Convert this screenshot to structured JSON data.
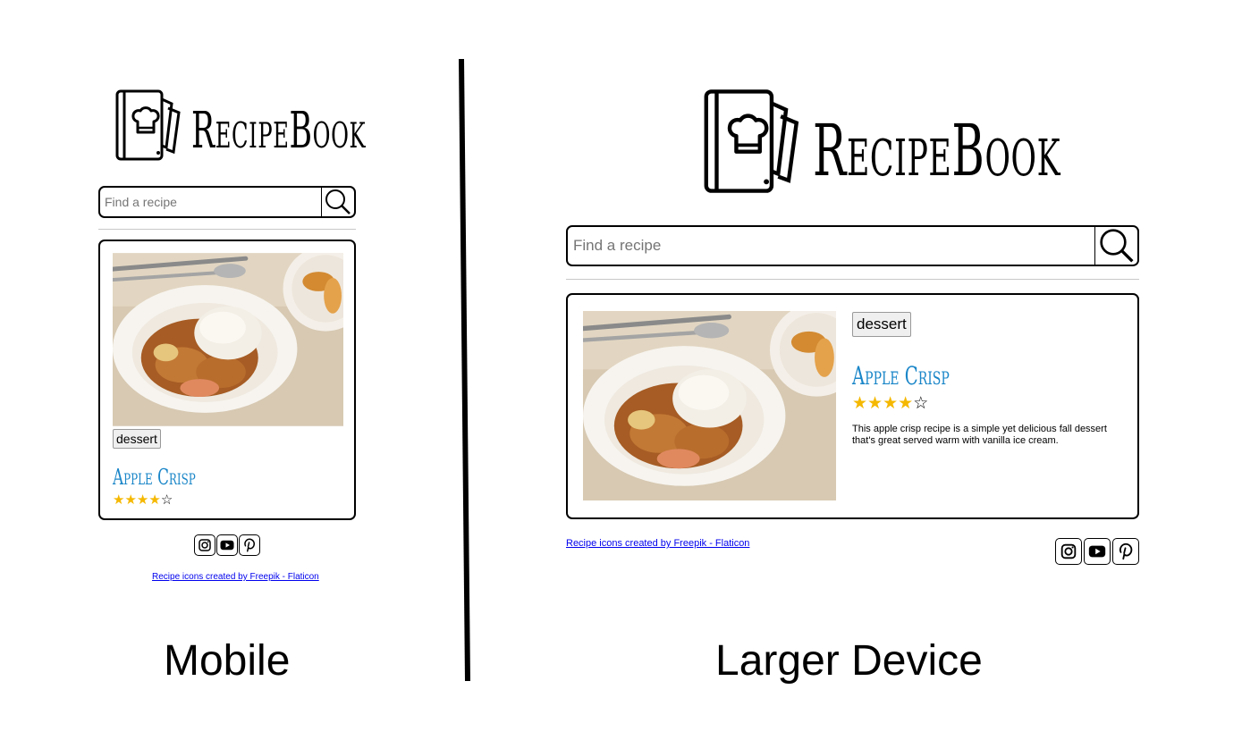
{
  "brand": {
    "name": "RecipeBook"
  },
  "search": {
    "placeholder": "Find a recipe"
  },
  "recipe": {
    "tag": "dessert",
    "title": "Apple Crisp",
    "rating": 4,
    "rating_max": 5,
    "stars": [
      "★",
      "★",
      "★",
      "★",
      "☆"
    ],
    "description": "This apple crisp recipe is a simple yet delicious fall dessert that's great served warm with vanilla ice cream."
  },
  "footer": {
    "credit": "Recipe icons created by Freepik - Flaticon"
  },
  "social": [
    "instagram-icon",
    "youtube-icon",
    "pinterest-icon"
  ],
  "captions": {
    "mobile": "Mobile",
    "desktop": "Larger Device"
  },
  "colors": {
    "title": "#1a86c8",
    "star": "#f5b800",
    "link": "#0000ee",
    "divider": "#c8c8c8"
  }
}
